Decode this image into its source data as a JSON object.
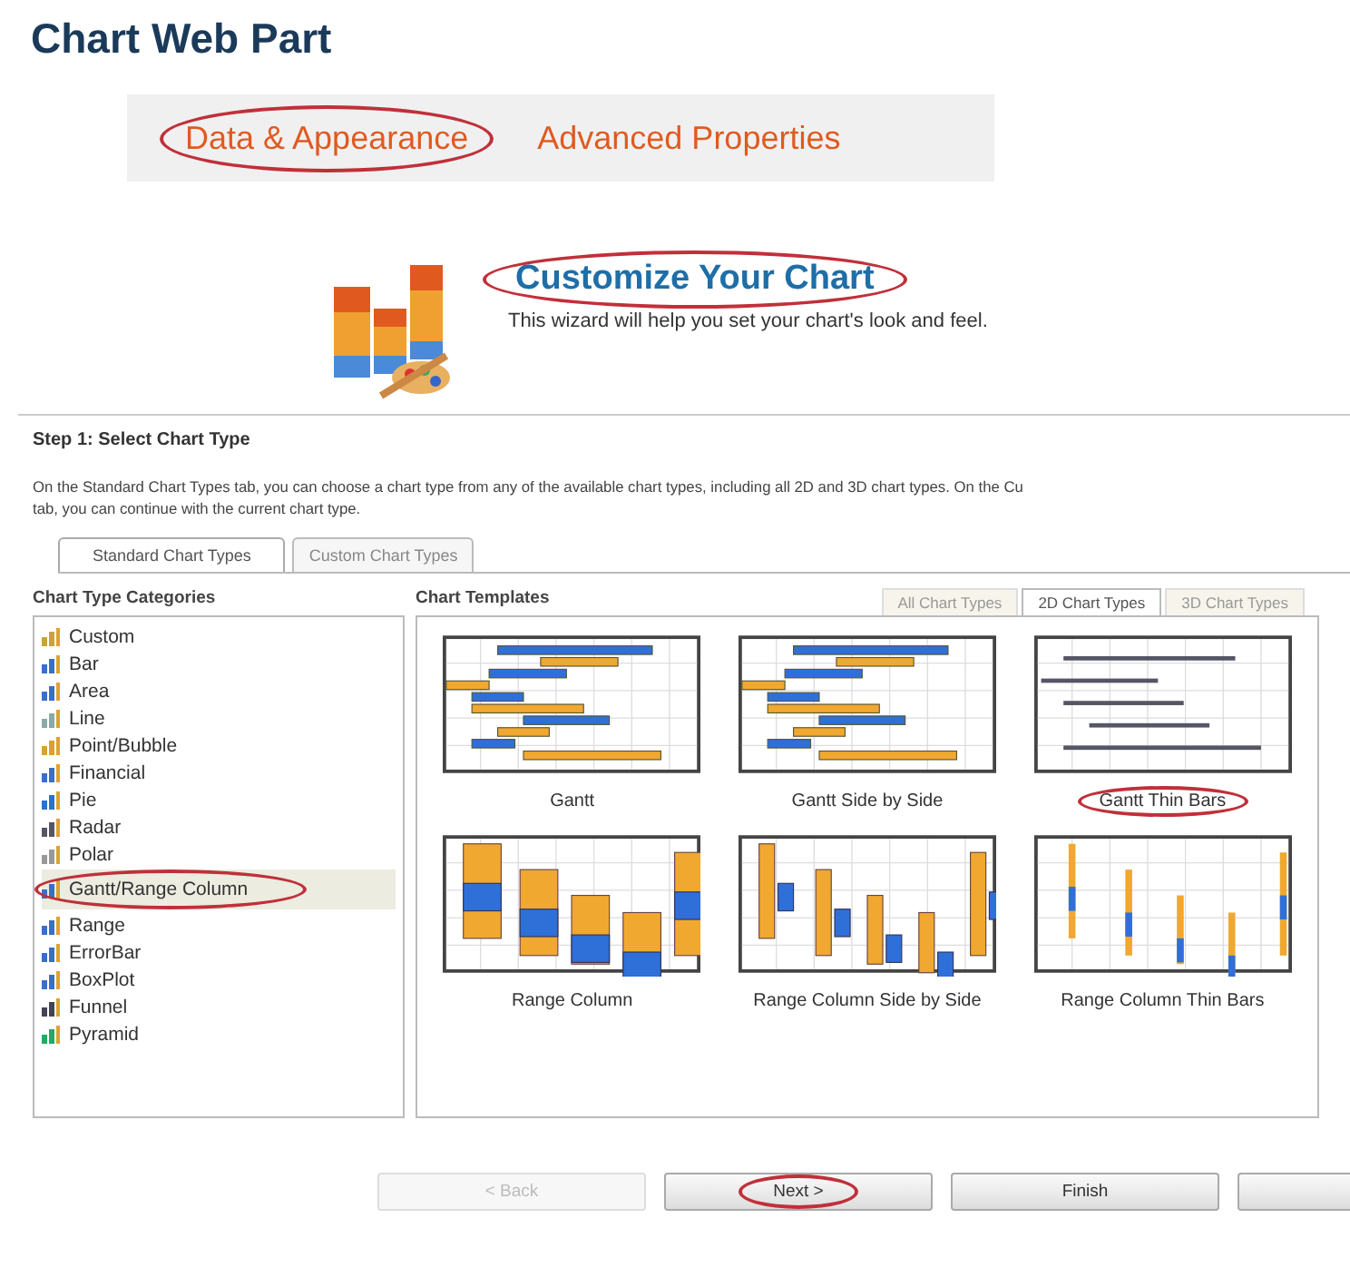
{
  "page_title": "Chart Web Part",
  "tabs": [
    {
      "label": "Data & Appearance",
      "annotated": true
    },
    {
      "label": "Advanced Properties",
      "annotated": false
    }
  ],
  "banner": {
    "title": "Customize Your Chart",
    "subtitle": "This wizard will help you set your chart's look and feel.",
    "annotated": true
  },
  "step": {
    "title": "Step 1: Select Chart Type",
    "description": "On the Standard Chart Types tab, you can choose a chart type from any of the available chart types, including all 2D and 3D chart types. On the Cu",
    "description_2": "tab, you can continue with the current chart type."
  },
  "step_tabs": [
    {
      "label": "Standard Chart Types",
      "selected": true
    },
    {
      "label": "Custom Chart Types",
      "selected": false
    }
  ],
  "categories": {
    "title": "Chart Type Categories",
    "items": [
      {
        "label": "Custom",
        "selected": false,
        "annotated": false
      },
      {
        "label": "Bar",
        "selected": false,
        "annotated": false
      },
      {
        "label": "Area",
        "selected": false,
        "annotated": false
      },
      {
        "label": "Line",
        "selected": false,
        "annotated": false
      },
      {
        "label": "Point/Bubble",
        "selected": false,
        "annotated": false
      },
      {
        "label": "Financial",
        "selected": false,
        "annotated": false
      },
      {
        "label": "Pie",
        "selected": false,
        "annotated": false
      },
      {
        "label": "Radar",
        "selected": false,
        "annotated": false
      },
      {
        "label": "Polar",
        "selected": false,
        "annotated": false
      },
      {
        "label": "Gantt/Range Column",
        "selected": true,
        "annotated": true
      },
      {
        "label": "Range",
        "selected": false,
        "annotated": false
      },
      {
        "label": "ErrorBar",
        "selected": false,
        "annotated": false
      },
      {
        "label": "BoxPlot",
        "selected": false,
        "annotated": false
      },
      {
        "label": "Funnel",
        "selected": false,
        "annotated": false
      },
      {
        "label": "Pyramid",
        "selected": false,
        "annotated": false
      }
    ]
  },
  "templates": {
    "title": "Chart Templates",
    "tabs": [
      {
        "label": "All Chart Types",
        "selected": false
      },
      {
        "label": "2D Chart Types",
        "selected": true
      },
      {
        "label": "3D Chart Types",
        "selected": false
      }
    ],
    "items": [
      {
        "label": "Gantt",
        "kind": "gantt",
        "annotated": false
      },
      {
        "label": "Gantt Side by Side",
        "kind": "gantt",
        "annotated": false
      },
      {
        "label": "Gantt Thin Bars",
        "kind": "gantt-thin",
        "annotated": true
      },
      {
        "label": "Range Column",
        "kind": "range",
        "annotated": false
      },
      {
        "label": "Range Column Side by Side",
        "kind": "range-side",
        "annotated": false
      },
      {
        "label": "Range Column Thin Bars",
        "kind": "range-thin",
        "annotated": false
      }
    ]
  },
  "buttons": [
    {
      "label": "< Back",
      "disabled": true,
      "annotated": false
    },
    {
      "label": "Next >",
      "disabled": false,
      "annotated": true
    },
    {
      "label": "Finish",
      "disabled": false,
      "annotated": false
    },
    {
      "disabled": false,
      "annotated": false
    }
  ]
}
